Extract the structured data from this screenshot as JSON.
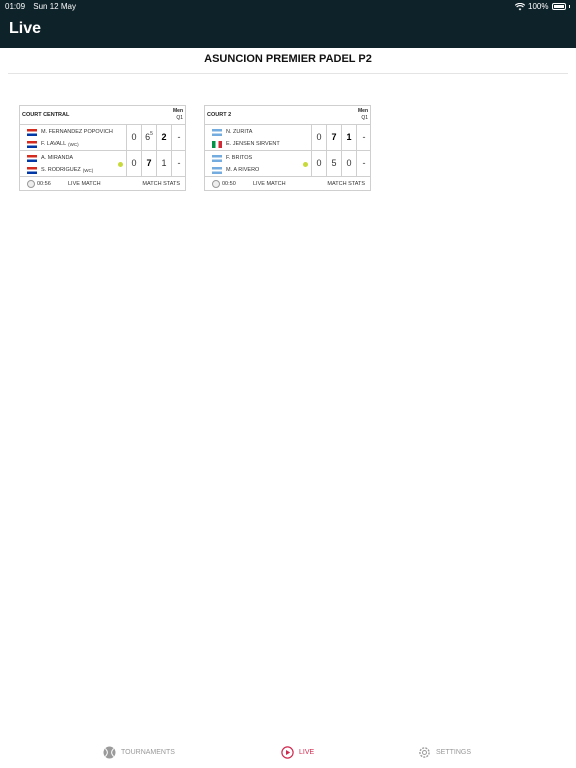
{
  "status_bar": {
    "time": "01:09",
    "date": "Sun 12 May",
    "battery": "100%"
  },
  "header": {
    "title": "Live"
  },
  "tournament": {
    "title": "ASUNCION PREMIER PADEL P2"
  },
  "matches": [
    {
      "court": "COURT CENTRAL",
      "category": [
        "Men",
        "Q1"
      ],
      "teams": [
        {
          "players": [
            {
              "name": "M. FERNANDEZ POPOVICH",
              "flag": "paraguay",
              "tag": ""
            },
            {
              "name": "F. LAVALL",
              "flag": "paraguay",
              "tag": "(WC)"
            }
          ],
          "serving": false,
          "scores": [
            "0",
            "6",
            "2",
            "-"
          ],
          "tiebreak": "5"
        },
        {
          "players": [
            {
              "name": "A. MIRANDA",
              "flag": "paraguay",
              "tag": ""
            },
            {
              "name": "S. RODRIGUEZ",
              "flag": "paraguay",
              "tag": "(WC)"
            }
          ],
          "serving": true,
          "scores": [
            "0",
            "7",
            "1",
            "-"
          ],
          "tiebreak": ""
        }
      ],
      "elapsed": "00:56",
      "live_label": "LIVE MATCH",
      "stats_label": "MATCH STATS"
    },
    {
      "court": "COURT 2",
      "category": [
        "Men",
        "Q1"
      ],
      "teams": [
        {
          "players": [
            {
              "name": "N. ZURITA",
              "flag": "argentina",
              "tag": ""
            },
            {
              "name": "E. JENSEN SIRVENT",
              "flag": "italy",
              "tag": ""
            }
          ],
          "serving": false,
          "scores": [
            "0",
            "7",
            "1",
            "-"
          ],
          "tiebreak": ""
        },
        {
          "players": [
            {
              "name": "F. BRITOS",
              "flag": "argentina",
              "tag": ""
            },
            {
              "name": "M. A RIVERO",
              "flag": "argentina",
              "tag": ""
            }
          ],
          "serving": true,
          "scores": [
            "0",
            "5",
            "0",
            "-"
          ],
          "tiebreak": ""
        }
      ],
      "elapsed": "00:50",
      "live_label": "LIVE MATCH",
      "stats_label": "MATCH STATS"
    }
  ],
  "tabbar": {
    "tournaments": "TOURNAMENTS",
    "live": "LIVE",
    "settings": "SETTINGS"
  },
  "colors": {
    "header_bg": "#0e2229",
    "accent": "#d12a4f",
    "serve": "#c8d93a"
  }
}
